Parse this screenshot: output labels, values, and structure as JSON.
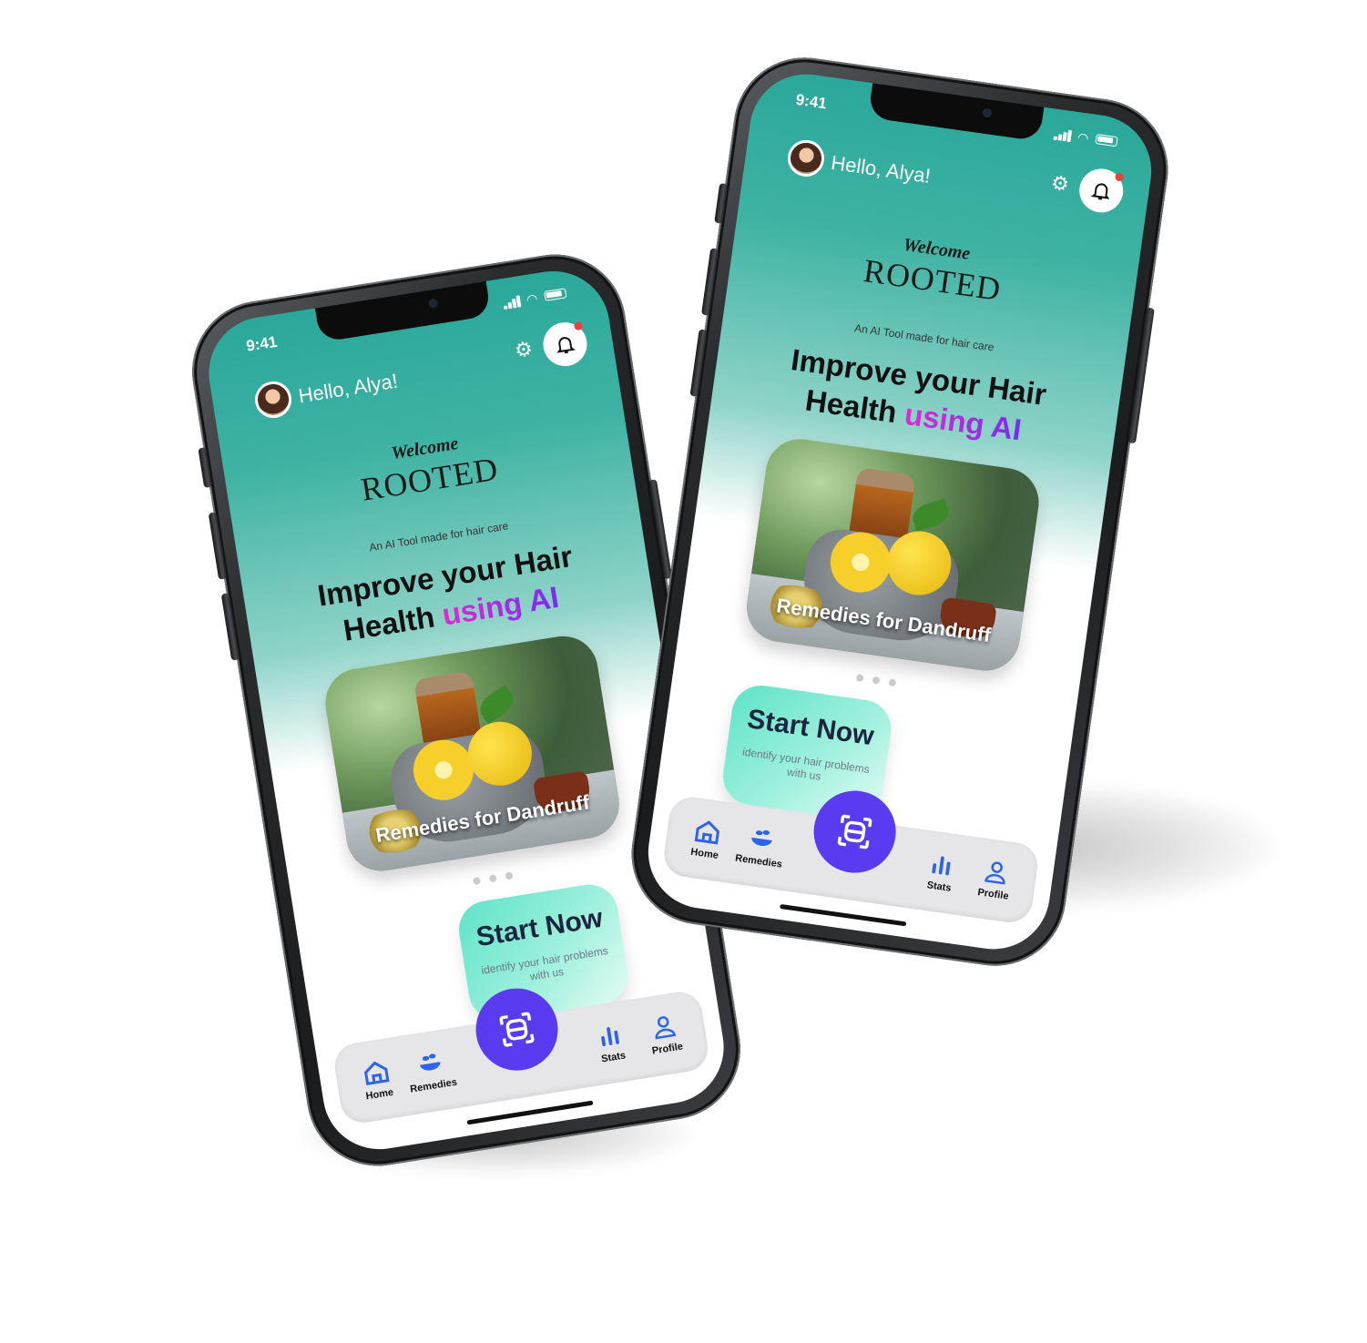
{
  "status_bar": {
    "time": "9:41"
  },
  "header": {
    "greeting": "Hello, Alya!"
  },
  "hero": {
    "welcome": "Welcome",
    "brand": "ROOTED",
    "tagline": "An AI Tool made for hair care",
    "headline_line1": "Improve your Hair",
    "headline_line2_plain": "Health ",
    "headline_line2_accent": "using AI"
  },
  "carousel": {
    "card_label": "Remedies for Dandruff",
    "page_count": 3
  },
  "cta": {
    "title": "Start Now",
    "subtitle": "identify your hair problems with us"
  },
  "nav": {
    "home": "Home",
    "remedies": "Remedies",
    "stats": "Stats",
    "profile": "Profile"
  },
  "colors": {
    "teal_top": "#2aa89a",
    "accent_purple": "#5b3bf0",
    "nav_icon_blue": "#2f63ea",
    "ai_gradient_start": "#e02bd0",
    "ai_gradient_end": "#7a2bf5",
    "notification_dot": "#e8423b"
  },
  "icons": [
    "settings-gear-icon",
    "bell-icon",
    "home-icon",
    "mortar-herb-icon",
    "face-scan-icon",
    "bar-chart-icon",
    "user-icon"
  ]
}
